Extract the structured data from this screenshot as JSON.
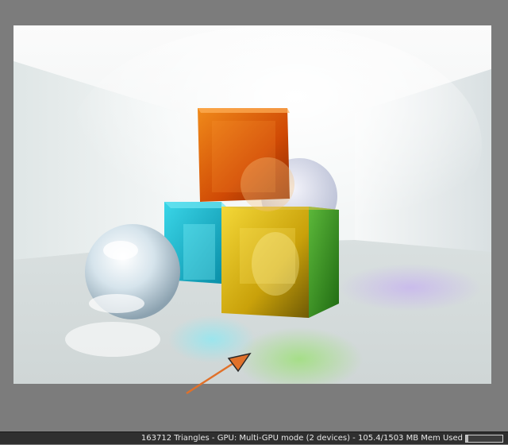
{
  "status": {
    "text": "163712 Triangles - GPU: Multi-GPU mode (2 devices) - 105.4/1503 MB Mem Used",
    "mem_used_fraction": 0.07
  },
  "colors": {
    "background": "#7c7c7c",
    "statusbar": "#2f2f2f",
    "annotation_arrow": "#e0712a"
  },
  "icons": {
    "annotation": "arrow-icon"
  }
}
